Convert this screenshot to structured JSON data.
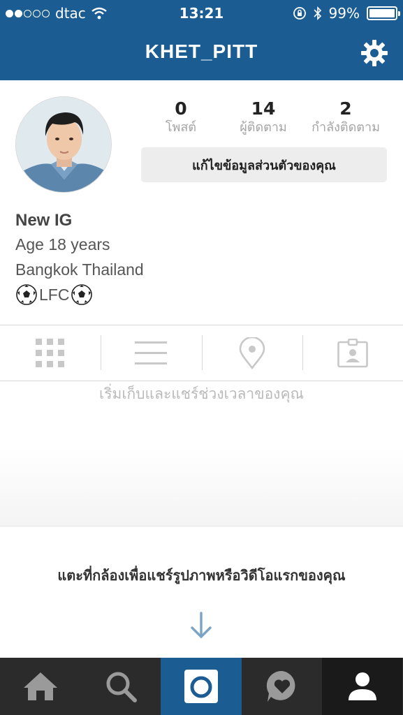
{
  "status_bar": {
    "carrier": "dtac",
    "time": "13:21",
    "battery": "99%",
    "battery_level": 0.99,
    "signal_bars": 2,
    "signal_total": 5
  },
  "nav": {
    "title": "KHET_PITT",
    "settings_icon": "gear-icon"
  },
  "profile": {
    "stats": [
      {
        "value": "0",
        "label": "โพสต์"
      },
      {
        "value": "14",
        "label": "ผู้ติดตาม"
      },
      {
        "value": "2",
        "label": "กำลังติดตาม"
      }
    ],
    "edit_button": "แก้ไขข้อมูลส่วนตัวของคุณ",
    "bio": {
      "name": "New IG",
      "line1": "Age 18 years",
      "line2": "Bangkok Thailand",
      "line3": "LFC",
      "line3_icon": "soccer-ball-icon"
    }
  },
  "tabs": [
    {
      "icon": "grid-icon"
    },
    {
      "icon": "list-icon"
    },
    {
      "icon": "location-pin-icon"
    },
    {
      "icon": "tagged-photos-icon"
    }
  ],
  "empty_state": {
    "message": "เริ่มเก็บและแชร์ช่วงเวลาของคุณ",
    "prompt": "แตะที่กล้องเพื่อแชร์รูปภาพหรือวิดีโอแรกของคุณ",
    "arrow_icon": "arrow-down-icon"
  },
  "bottom_nav": [
    {
      "icon": "home-icon"
    },
    {
      "icon": "search-icon"
    },
    {
      "icon": "camera-icon"
    },
    {
      "icon": "activity-heart-icon"
    },
    {
      "icon": "profile-icon"
    }
  ],
  "colors": {
    "brand_blue": "#1b5c93",
    "bottom_bar": "#2b2b2b",
    "active_tab": "#1a1a1a",
    "muted_icon": "#c8c8c8"
  }
}
